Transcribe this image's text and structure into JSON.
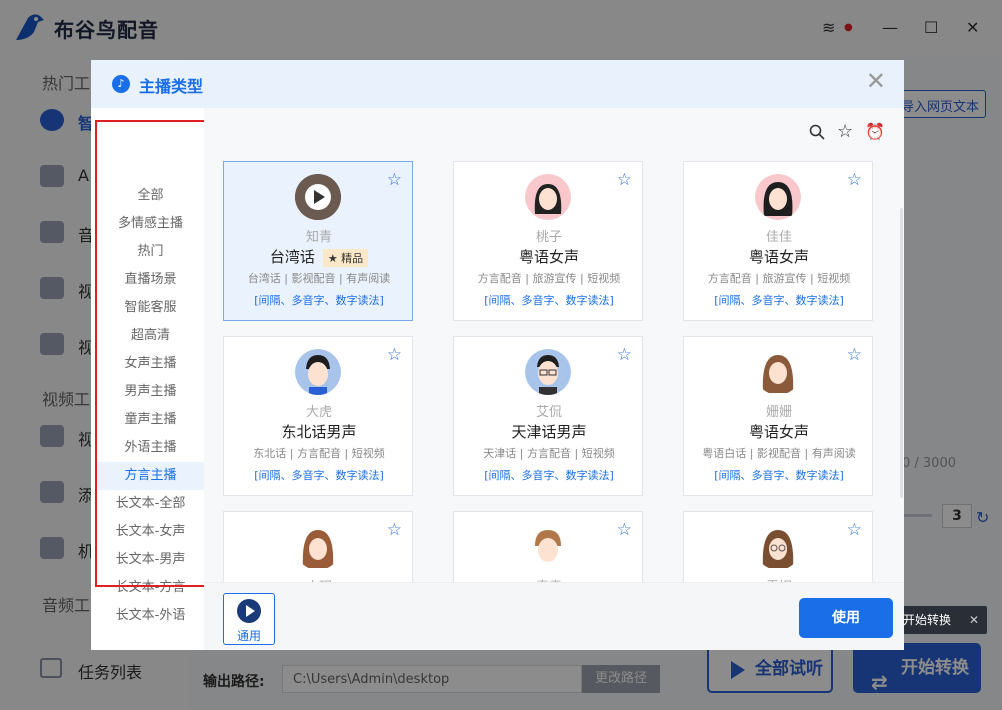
{
  "app": {
    "title": "布谷鸟配音",
    "sidebar": {
      "section_hot": "热门工",
      "section_video": "视频工",
      "section_audio": "音频工",
      "items": [
        {
          "label": "智"
        },
        {
          "label": "A"
        },
        {
          "label": "音"
        },
        {
          "label": "视"
        },
        {
          "label": "视"
        },
        {
          "label": "视"
        },
        {
          "label": "添"
        },
        {
          "label": "机"
        }
      ],
      "task_list": "任务列表"
    },
    "import_web_text": "导入网页文本",
    "char_count": "0 / 3000",
    "speed_value": "3",
    "output_label": "输出路径:",
    "output_path": "C:\\Users\\Admin\\desktop",
    "change_path": "更改路径",
    "preview_all": "全部试听",
    "start_convert": "开始转换",
    "tooltip": "开始转换"
  },
  "modal": {
    "title": "主播类型",
    "categories": [
      "全部",
      "多情感主播",
      "热门",
      "直播场景",
      "智能客服",
      "超高清",
      "女声主播",
      "男声主播",
      "童声主播",
      "外语主播",
      "方言主播",
      "长文本-全部",
      "长文本-女声",
      "长文本-男声",
      "长文本-方言",
      "长文本-外语"
    ],
    "active_category": "方言主播",
    "cards": [
      {
        "name": "知青",
        "type": "台湾话",
        "badge": "★ 精品",
        "tags": "台湾话 | 影视配音 | 有声阅读",
        "link": "[间隔、多音字、数字读法]"
      },
      {
        "name": "桃子",
        "type": "粤语女声",
        "tags": "方言配音 | 旅游宣传 | 短视频",
        "link": "[间隔、多音字、数字读法]"
      },
      {
        "name": "佳佳",
        "type": "粤语女声",
        "tags": "方言配音 | 旅游宣传 | 短视频",
        "link": "[间隔、多音字、数字读法]"
      },
      {
        "name": "大虎",
        "type": "东北话男声",
        "tags": "东北话 | 方言配音 | 短视频",
        "link": "[间隔、多音字、数字读法]"
      },
      {
        "name": "艾侃",
        "type": "天津话男声",
        "tags": "天津话 | 方言配音 | 短视频",
        "link": "[间隔、多音字、数字读法]"
      },
      {
        "name": "姗姗",
        "type": "粤语女声",
        "tags": "粤语白话 | 影视配音 | 有声阅读",
        "link": "[间隔、多音字、数字读法]"
      },
      {
        "name": "小玥",
        "type": "",
        "tags": "",
        "link": ""
      },
      {
        "name": "青青",
        "type": "",
        "tags": "",
        "link": ""
      },
      {
        "name": "露妮",
        "type": "",
        "tags": "",
        "link": ""
      }
    ],
    "general_label": "通用",
    "use_button": "使用"
  },
  "colors": {
    "accent": "#1a6fe8",
    "highlight_border": "#e02020",
    "selected_card": "#eaf2fd"
  }
}
